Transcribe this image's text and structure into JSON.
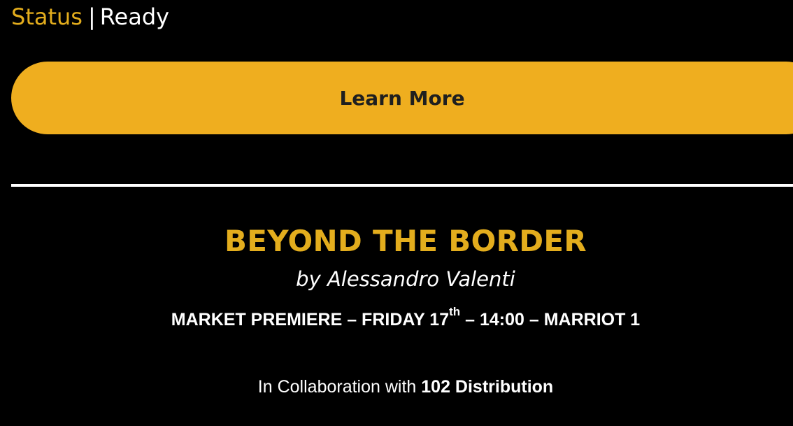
{
  "status": {
    "label": "Status",
    "separator": "|",
    "value": "Ready"
  },
  "cta": {
    "label": "Learn More"
  },
  "film": {
    "title": "BEYOND THE BORDER",
    "author": "by Alessandro Valenti",
    "screening": {
      "prefix": "MARKET PREMIERE – FRIDAY 17",
      "superscript": "th",
      "suffix": " – 14:00 – MARRIOT 1"
    },
    "collaboration": {
      "prefix": "In Collaboration with ",
      "partner": "102 Distribution"
    }
  },
  "colors": {
    "background": "#000000",
    "accent": "#e3ad1d",
    "button": "#efae1f",
    "text": "#ffffff"
  }
}
